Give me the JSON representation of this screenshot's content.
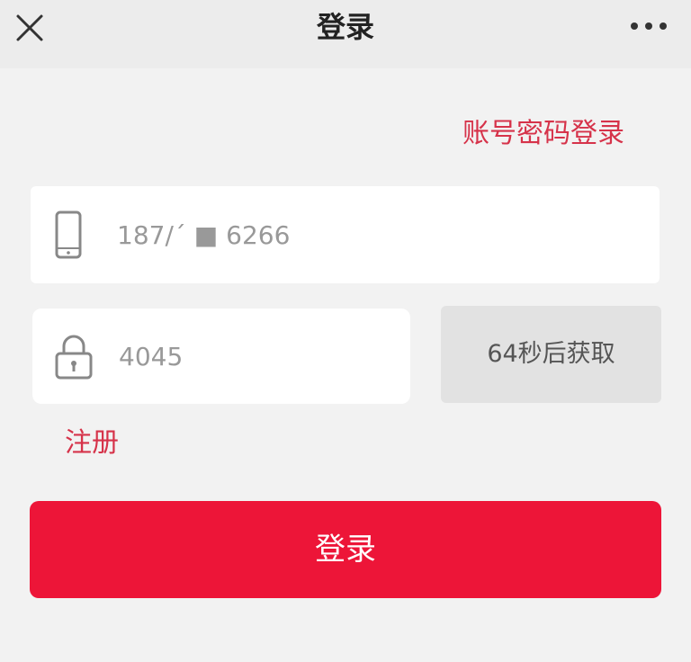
{
  "nav": {
    "title": "登录",
    "close_icon": "close-icon",
    "more_icon": "more-horizontal-icon"
  },
  "switch_link": "账号密码登录",
  "phone_field": {
    "icon": "phone-icon",
    "value": "187/ˊ ■ 6266"
  },
  "code_field": {
    "icon": "lock-icon",
    "value": "4045"
  },
  "code_button": "64秒后获取",
  "register_link": "注册",
  "submit_button": "登录",
  "colors": {
    "accent": "#ed1538",
    "link": "#d6334a",
    "background": "#f2f2f2",
    "disabled_button": "#e2e2e2"
  }
}
